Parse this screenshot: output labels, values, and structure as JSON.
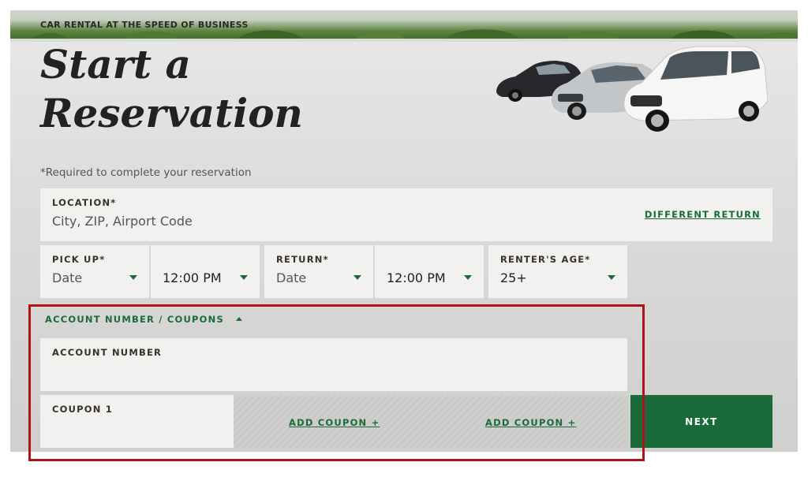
{
  "header": {
    "tagline": "CAR RENTAL AT THE SPEED OF BUSINESS",
    "title_line1": "Start a",
    "title_line2": "Reservation"
  },
  "form": {
    "required_note": "*Required to complete your reservation",
    "location": {
      "label": "LOCATION*",
      "placeholder": "City, ZIP, Airport Code",
      "different_return_link": "DIFFERENT RETURN"
    },
    "pickup": {
      "label": "PICK UP*",
      "date_value": "Date",
      "time_value": "12:00 PM"
    },
    "return": {
      "label": "RETURN*",
      "date_value": "Date",
      "time_value": "12:00 PM"
    },
    "renter_age": {
      "label": "RENTER'S AGE*",
      "value": "25+"
    },
    "account_coupons": {
      "toggle_label": "ACCOUNT NUMBER / COUPONS",
      "account_number_label": "ACCOUNT NUMBER",
      "coupon1_label": "COUPON 1",
      "add_coupon_label_1": "ADD COUPON +",
      "add_coupon_label_2": "ADD COUPON +"
    },
    "next_label": "NEXT"
  },
  "icons": {
    "dropdown": "chevron-down-icon",
    "toggle": "chevron-up-icon"
  },
  "colors": {
    "brand_green": "#1b6b3a",
    "highlight_red": "#b0121b"
  }
}
